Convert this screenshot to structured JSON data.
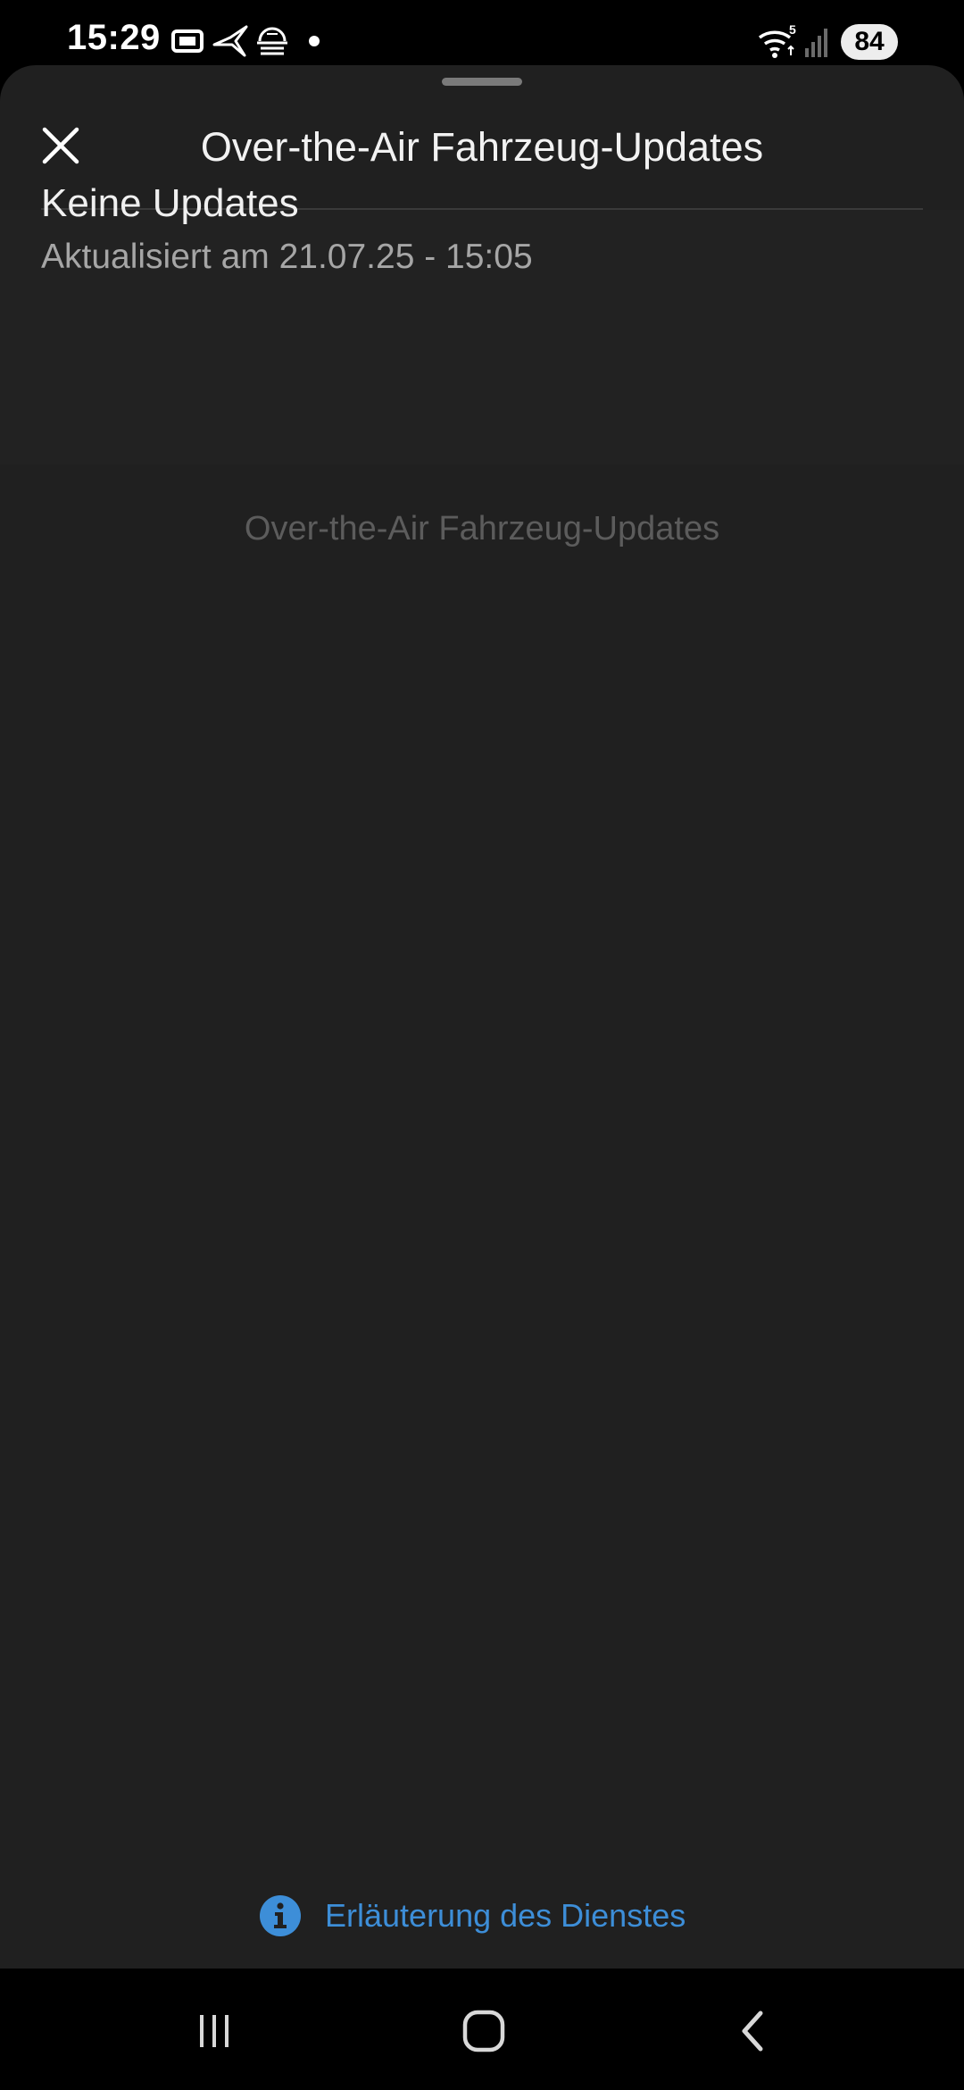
{
  "status_bar": {
    "time": "15:29",
    "battery": "84",
    "icons": [
      "sim-card-icon",
      "bird-app-icon",
      "dome-app-icon",
      "notification-dot-icon",
      "wifi-icon",
      "signal-icon",
      "battery-icon"
    ]
  },
  "sheet": {
    "title": "Over-the-Air Fahrzeug-Updates",
    "status_heading": "Keine Updates",
    "status_subtitle": "Aktualisiert am 21.07.25 - 15:05",
    "placeholder_title": "Over-the-Air Fahrzeug-Updates",
    "info_link_label": "Erläuterung des Dienstes"
  },
  "colors": {
    "background": "#202020",
    "accent": "#3d8ed8",
    "text_primary": "#f0f0f0",
    "text_secondary": "#a6a6a6"
  },
  "nav_bar": {
    "buttons": [
      "recent-apps-icon",
      "home-icon",
      "back-icon"
    ]
  }
}
